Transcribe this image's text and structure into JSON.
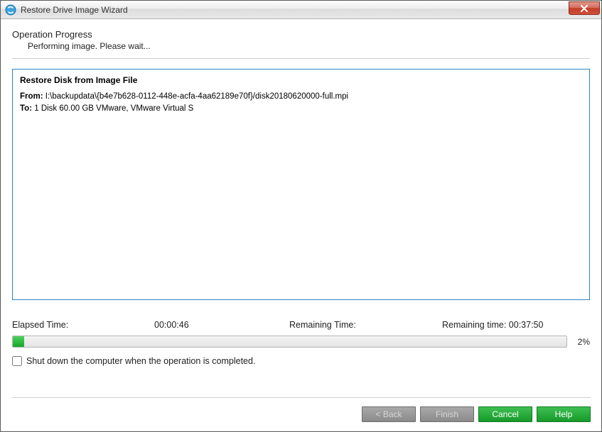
{
  "window": {
    "title": "Restore Drive Image Wizard"
  },
  "header": {
    "title": "Operation Progress",
    "subtitle": "Performing image. Please wait..."
  },
  "panel": {
    "title": "Restore Disk from Image File",
    "from_label": "From:",
    "from_value": "I:\\backupdata\\{b4e7b628-0112-448e-acfa-4aa62189e70f}/disk20180620000-full.mpi",
    "to_label": "To:",
    "to_value": "1 Disk 60.00 GB VMware, VMware Virtual S"
  },
  "progress": {
    "elapsed_label": "Elapsed Time:",
    "elapsed_value": "00:00:46",
    "remaining_label": "Remaining Time:",
    "remaining_text": "Remaining time: 00:37:50",
    "percent": 2,
    "percent_text": "2%"
  },
  "options": {
    "shutdown_label": "Shut down the computer when the operation is completed."
  },
  "buttons": {
    "back": "< Back",
    "finish": "Finish",
    "cancel": "Cancel",
    "help": "Help"
  }
}
